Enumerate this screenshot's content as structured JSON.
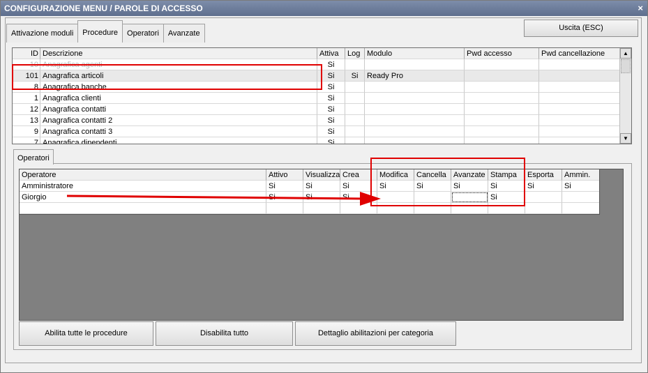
{
  "window": {
    "title": "CONFIGURAZIONE MENU / PAROLE DI ACCESSO",
    "close_label": "×"
  },
  "tabs": [
    {
      "label": "Attivazione moduli"
    },
    {
      "label": "Procedure"
    },
    {
      "label": "Operatori"
    },
    {
      "label": "Avanzate"
    }
  ],
  "active_tab": "Procedure",
  "exit_button": "Uscita (ESC)",
  "procedures_grid": {
    "columns": [
      "ID",
      "Descrizione",
      "Attiva",
      "Log",
      "Modulo",
      "Pwd accesso",
      "Pwd cancellazione"
    ],
    "rows": [
      {
        "id": "10",
        "descrizione": "Anagrafica agenti",
        "attiva": "Si",
        "log": "",
        "modulo": ""
      },
      {
        "id": "101",
        "descrizione": "Anagrafica articoli",
        "attiva": "Si",
        "log": "Si",
        "modulo": "Ready Pro"
      },
      {
        "id": "8",
        "descrizione": "Anagrafica banche",
        "attiva": "Si",
        "log": "",
        "modulo": ""
      },
      {
        "id": "1",
        "descrizione": "Anagrafica clienti",
        "attiva": "Si",
        "log": "",
        "modulo": ""
      },
      {
        "id": "12",
        "descrizione": "Anagrafica contatti",
        "attiva": "Si",
        "log": "",
        "modulo": ""
      },
      {
        "id": "13",
        "descrizione": "Anagrafica contatti 2",
        "attiva": "Si",
        "log": "",
        "modulo": ""
      },
      {
        "id": "9",
        "descrizione": "Anagrafica contatti 3",
        "attiva": "Si",
        "log": "",
        "modulo": ""
      },
      {
        "id": "7",
        "descrizione": "Anagrafica dipendenti",
        "attiva": "Si",
        "log": "",
        "modulo": ""
      }
    ],
    "scroll_up": "▲",
    "scroll_down": "▼"
  },
  "operators_tab": {
    "label": "Operatori"
  },
  "operators_grid": {
    "columns": [
      "Operatore",
      "Attivo",
      "Visualizza",
      "Crea",
      "Modifica",
      "Cancella",
      "Avanzate",
      "Stampa",
      "Esporta",
      "Ammin."
    ],
    "rows": [
      {
        "operatore": "Amministratore",
        "attivo": "Si",
        "visualizza": "Si",
        "crea": "Si",
        "modifica": "Si",
        "cancella": "Si",
        "avanzate": "Si",
        "stampa": "Si",
        "esporta": "Si",
        "ammin": "Si"
      },
      {
        "operatore": "Giorgio",
        "attivo": "Si",
        "visualizza": "Si",
        "crea": "Si",
        "modifica": "",
        "cancella": "",
        "avanzate": "",
        "stampa": "Si",
        "esporta": "",
        "ammin": ""
      }
    ]
  },
  "buttons": {
    "enable_all": "Abilita tutte le procedure",
    "disable_all": "Disabilita tutto",
    "category_detail": "Dettaglio abilitazioni per categoria"
  },
  "colors": {
    "annotation": "#e00000",
    "titlebar": "#6b7b99"
  }
}
